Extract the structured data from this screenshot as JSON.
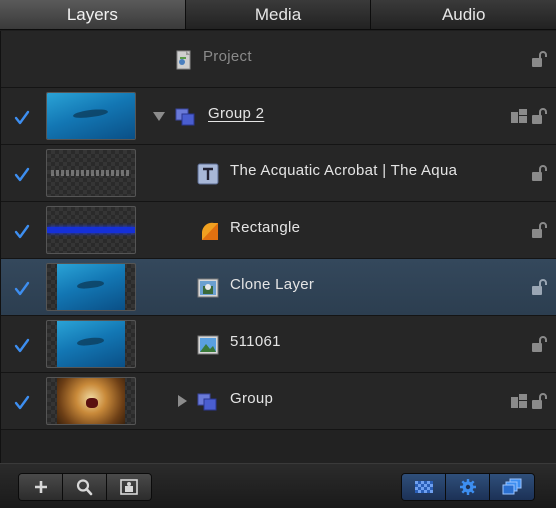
{
  "tabs": [
    {
      "label": "Layers",
      "active": true
    },
    {
      "label": "Media",
      "active": false
    },
    {
      "label": "Audio",
      "active": false
    }
  ],
  "rows": [
    {
      "label": "Project",
      "icon": "project-icon",
      "checked": null,
      "selected": false
    },
    {
      "label": "Group 2",
      "icon": "group-icon",
      "checked": true,
      "selected": false,
      "disclosure": "open",
      "isolate": true
    },
    {
      "label": "The Acquatic Acrobat | The Aqua",
      "icon": "text-layer-icon",
      "checked": true,
      "selected": false
    },
    {
      "label": "Rectangle",
      "icon": "shape-icon",
      "checked": true,
      "selected": false
    },
    {
      "label": "Clone Layer",
      "icon": "clone-layer-icon",
      "checked": true,
      "selected": true
    },
    {
      "label": "511061",
      "icon": "image-layer-icon",
      "checked": true,
      "selected": false
    },
    {
      "label": "Group",
      "icon": "group-icon",
      "checked": true,
      "selected": false,
      "disclosure": "closed",
      "isolate": true
    }
  ],
  "toolbar": {
    "left_buttons": [
      "plus-icon",
      "search-icon",
      "placeholder-icon"
    ],
    "right_buttons": [
      "checkerboard-icon",
      "gear-icon",
      "layers-stack-icon"
    ]
  },
  "colors": {
    "selected_row": "#30455a",
    "check_blue": "#3d8ef0",
    "rectangle_fill": "#1530d8"
  }
}
